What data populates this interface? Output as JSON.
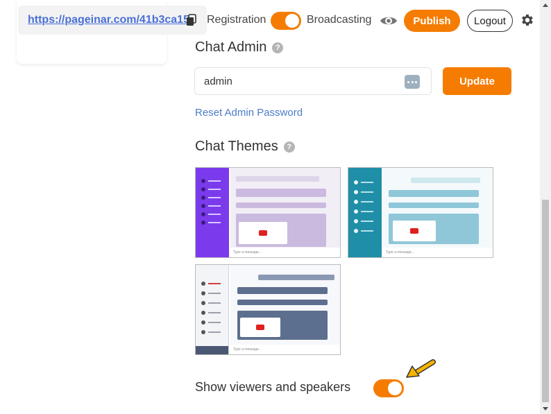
{
  "header": {
    "url_text": "https://pageinar.com/41b3ca15",
    "registration_label": "Registration",
    "registration_on": true,
    "broadcasting_label": "Broadcasting",
    "publish_label": "Publish",
    "logout_label": "Logout"
  },
  "chat_admin": {
    "title": "Chat Admin",
    "help": "?",
    "admin_value": "admin",
    "update_label": "Update",
    "reset_label": "Reset Admin Password"
  },
  "chat_themes": {
    "title": "Chat Themes",
    "help": "?",
    "themes": [
      {
        "name": "purple",
        "side_color": "#7c3aed",
        "chat_bg": "#ede6f5",
        "bubble_color": "#cbbadf"
      },
      {
        "name": "teal",
        "side_color": "#1f8fa8",
        "chat_bg": "#e9f4f7",
        "bubble_color": "#8fc7d8"
      },
      {
        "name": "slate",
        "side_color": "#f2f4f8",
        "chat_bg": "#eef0f5",
        "bubble_color": "#5d6f8e"
      }
    ],
    "input_placeholder": "Type a message..."
  },
  "viewers": {
    "label": "Show viewers and speakers",
    "enabled": true
  },
  "colors": {
    "accent": "#f57c00",
    "link": "#4a7bc8"
  }
}
